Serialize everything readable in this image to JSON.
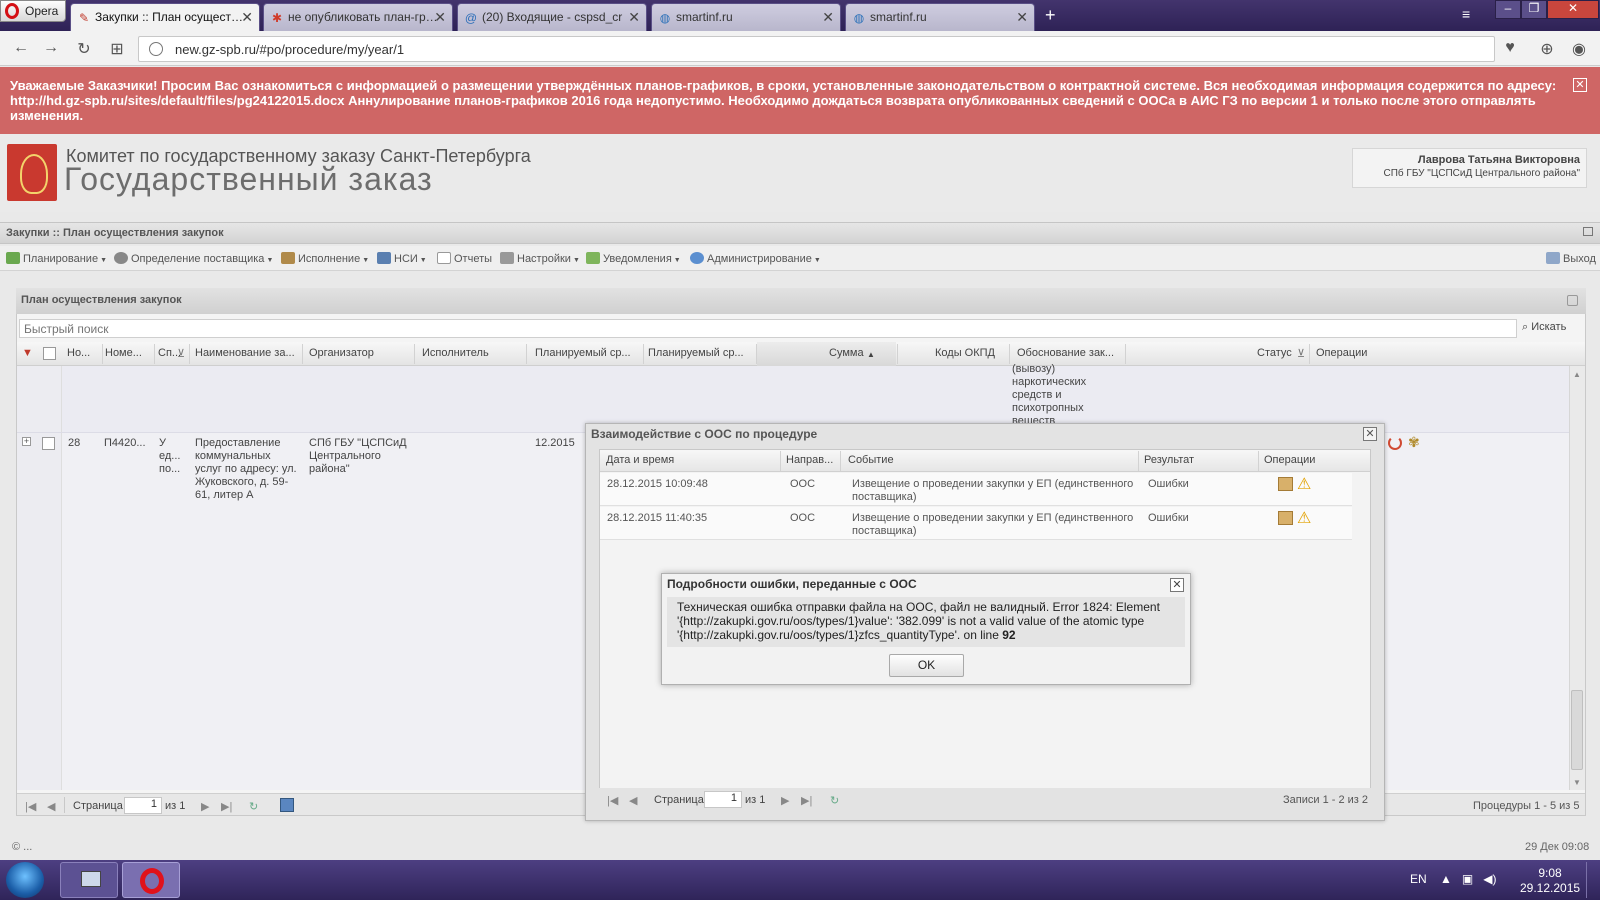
{
  "browser": {
    "opera_label": "Opera",
    "tabs": [
      {
        "label": "Закупки :: План осуществления",
        "icon": "gz-icon"
      },
      {
        "label": "не опубликовать план-график",
        "icon": "spb-icon"
      },
      {
        "label": "(20) Входящие - cspsd_cr",
        "icon": "mail-icon"
      },
      {
        "label": "smartinf.ru",
        "icon": "globe-icon"
      },
      {
        "label": "smartinf.ru",
        "icon": "globe-icon"
      }
    ],
    "url": "new.gz-spb.ru/#po/procedure/my/year/1"
  },
  "alert": {
    "text": "Уважаемые Заказчики! Просим Вас ознакомиться с информацией о размещении утверждённых планов-графиков, в сроки, установленные законодательством о контрактной системе. Вся необходимая информация содержится по адресу: http://hd.gz-spb.ru/sites/default/files/pg24122015.docx Аннулирование планов-графиков 2016 года недопустимо. Необходимо дождаться возврата опубликованных сведений с ООСа в АИС ГЗ по версии 1 и только после этого отправлять изменения.",
    "bg_color": "#cf6665"
  },
  "header": {
    "committee": "Комитет по государственному заказу Санкт-Петербурга",
    "title": "Государственный заказ",
    "user_name": "Лаврова Татьяна Викторовна",
    "user_org": "СПб ГБУ \"ЦСПСиД Центрального района\""
  },
  "breadcrumb": "Закупки :: План осуществления закупок",
  "menu": {
    "items": [
      "Планирование",
      "Определение поставщика",
      "Исполнение",
      "НСИ",
      "Отчеты",
      "Настройки",
      "Уведомления",
      "Администрирование"
    ],
    "exit": "Выход"
  },
  "panel": {
    "title": "План осуществления закупок",
    "search_placeholder": "Быстрый поиск",
    "search_button": "Искать",
    "columns": [
      "Но...",
      "Номе...",
      "Сп...",
      "Наименование за...",
      "Организатор",
      "Исполнитель",
      "Планируемый ср...",
      "Планируемый ср...",
      "Сумма",
      "Коды ОКПД",
      "Обоснование зак...",
      "Статус",
      "Операции"
    ],
    "prev_row_text": "(вывозу)\nнаркотических\nсредств и\nпсихотропных\nвеществ",
    "row": {
      "num": "28",
      "number": "П4420...",
      "method": "У\nед...\nпо...",
      "name": "Предоставление\nкоммунальных\nуслуг по адресу: ул.\nЖуковского, д. 59-\n61, литер А",
      "organizer": "СПб ГБУ \"ЦСПСиД\nЦентрального\nрайона\"",
      "planned_date": "12.2015"
    },
    "pager": {
      "page_label": "Страница",
      "page": "1",
      "of": "из 1",
      "summary": "Процедуры 1 - 5 из 5"
    }
  },
  "footer": {
    "left": "© ...",
    "right": "29 Дек 09:08"
  },
  "dialog_ooc": {
    "title": "Взаимодействие с ООС по процедуре",
    "columns": [
      "Дата и время",
      "Направ...",
      "Событие",
      "Результат",
      "Операции"
    ],
    "rows": [
      {
        "datetime": "28.12.2015 10:09:48",
        "direction": "ООС",
        "event": "Извещение о проведении закупки у ЕП (единственного поставщика)",
        "result": "Ошибки"
      },
      {
        "datetime": "28.12.2015 11:40:35",
        "direction": "ООС",
        "event": "Извещение о проведении закупки у ЕП (единственного поставщика)",
        "result": "Ошибки"
      }
    ],
    "pager": {
      "page_label": "Страница",
      "page": "1",
      "of": "из 1",
      "summary": "Записи 1 - 2 из 2"
    }
  },
  "dialog_error": {
    "title": "Подробности ошибки, переданные с ООС",
    "message_line1": "Техническая ошибка отправки файла на ООС, файл не валидный. Error 1824: Element",
    "message_line2": "'{http://zakupki.gov.ru/oos/types/1}value': '382.099' is not a valid value of the atomic type",
    "message_line3_prefix": "'{http://zakupki.gov.ru/oos/types/1}zfcs_quantityType'. on line ",
    "message_line_number": "92",
    "ok_label": "OK"
  },
  "taskbar": {
    "lang": "EN",
    "time": "9:08",
    "date": "29.12.2015"
  }
}
